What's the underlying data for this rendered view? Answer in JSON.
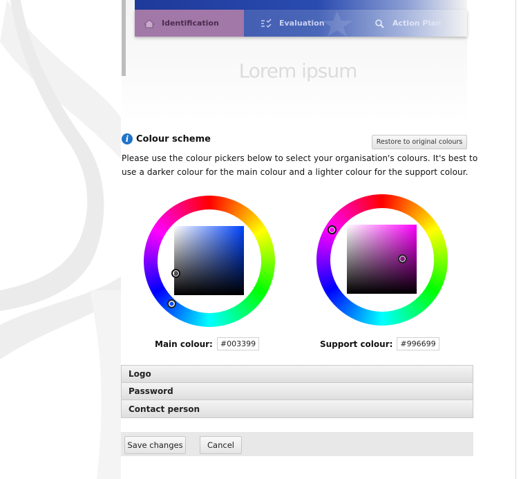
{
  "preview": {
    "tabs": [
      {
        "label": "Identification",
        "icon": "home-icon",
        "active": true
      },
      {
        "label": "Evaluation",
        "icon": "checklist-icon",
        "active": false
      },
      {
        "label": "Action Plan",
        "icon": "search-icon",
        "active": false
      }
    ],
    "title": "Lorem ipsum"
  },
  "colour_scheme": {
    "title": "Colour scheme",
    "info_icon": "info-icon",
    "restore_button": "Restore to original colours",
    "description": "Please use the colour pickers below to select your organisation's colours. It's best to use a darker colour for the main colour and a lighter colour for the support colour."
  },
  "pickers": {
    "main": {
      "label": "Main colour:",
      "value": "#003399",
      "hue": "#0044ff"
    },
    "support": {
      "label": "Support colour:",
      "value": "#996699",
      "hue": "#ff00ff"
    }
  },
  "accordion": [
    "Logo",
    "Password",
    "Contact person"
  ],
  "footer": {
    "save": "Save changes",
    "cancel": "Cancel"
  }
}
